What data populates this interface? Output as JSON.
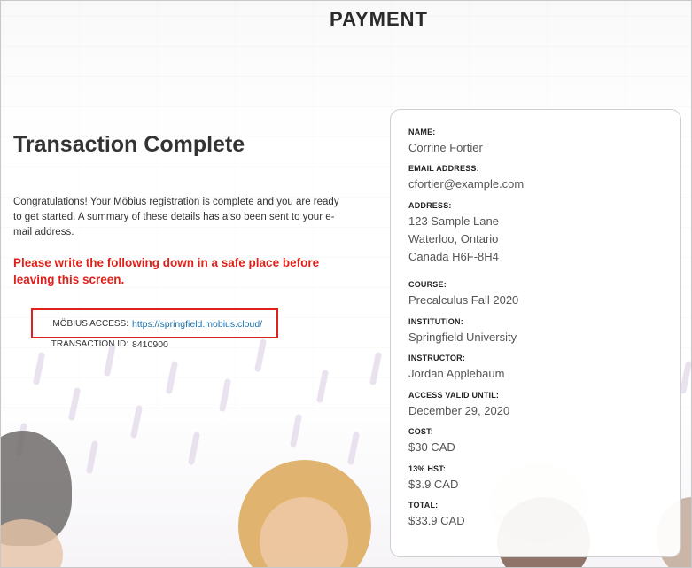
{
  "page": {
    "title": "PAYMENT"
  },
  "transaction": {
    "heading": "Transaction Complete",
    "message": "Congratulations! Your Möbius registration is complete and you are ready to get started. A summary of these details has also been sent to your e-mail address.",
    "warning": "Please write the following down in a safe place before leaving this screen.",
    "access_label": "MÖBIUS ACCESS:",
    "access_url": "https://springfield.mobius.cloud/",
    "id_label": "TRANSACTION ID:",
    "id_value": "8410900"
  },
  "summary": {
    "name_label": "NAME:",
    "name": "Corrine Fortier",
    "email_label": "EMAIL ADDRESS:",
    "email": "cfortier@example.com",
    "address_label": "ADDRESS:",
    "address_line1": "123 Sample Lane",
    "address_line2": "Waterloo, Ontario",
    "address_line3": "Canada H6F-8H4",
    "course_label": "COURSE:",
    "course": "Precalculus Fall 2020",
    "institution_label": "INSTITUTION:",
    "institution": "Springfield University",
    "instructor_label": "INSTRUCTOR:",
    "instructor": "Jordan Applebaum",
    "valid_label": "ACCESS VALID UNTIL:",
    "valid_until": "December 29, 2020",
    "cost_label": "COST:",
    "cost": "$30 CAD",
    "tax_label": "13% HST:",
    "tax": "$3.9 CAD",
    "total_label": "TOTAL:",
    "total": "$33.9 CAD"
  },
  "colors": {
    "warning": "#e0201b",
    "link": "#1a6fa8",
    "highlight_border": "#e0201b"
  }
}
